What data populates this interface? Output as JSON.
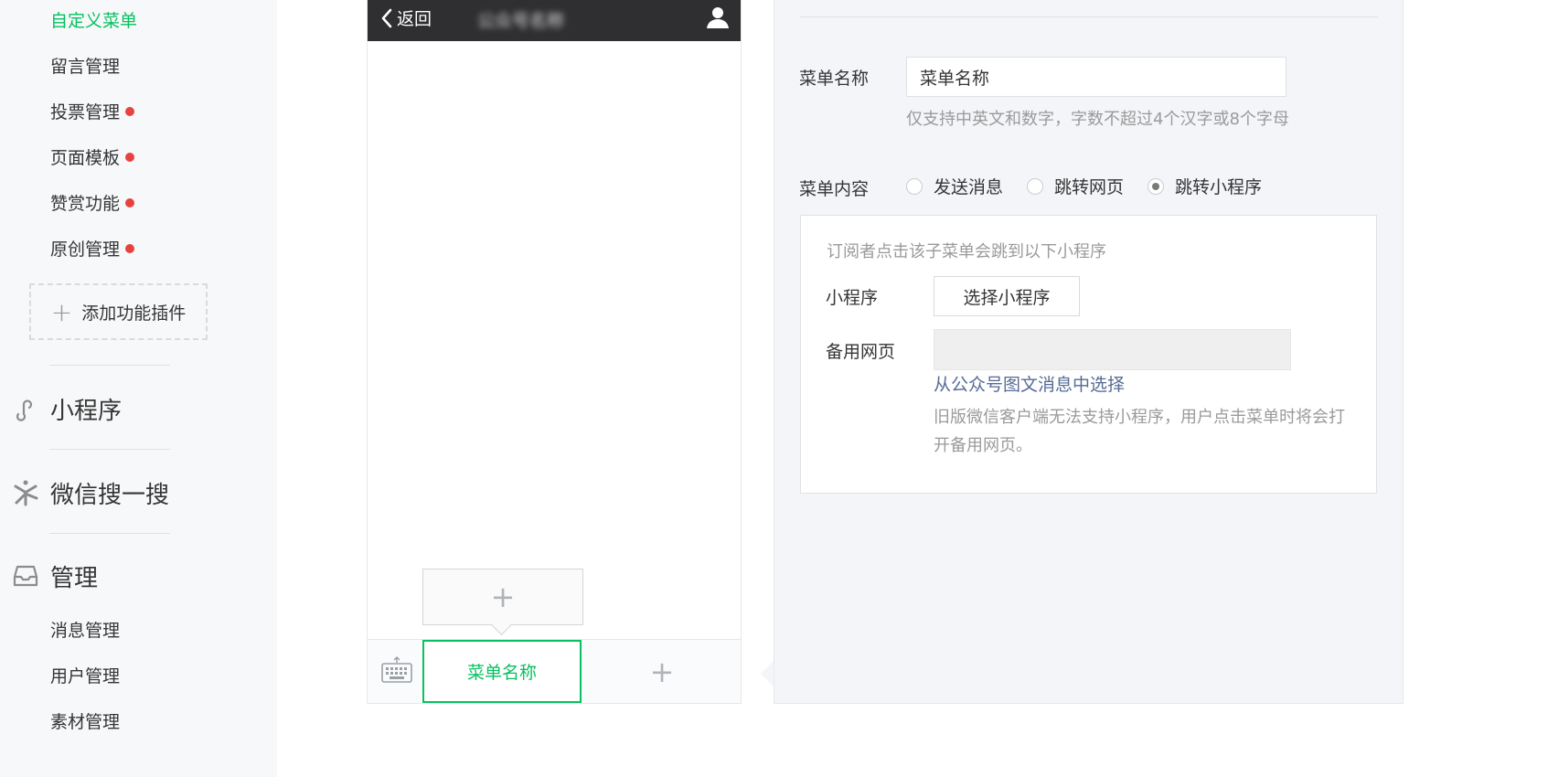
{
  "sidebar": {
    "items": [
      {
        "label": "自定义菜单",
        "active": true,
        "dot": false
      },
      {
        "label": "留言管理",
        "active": false,
        "dot": false
      },
      {
        "label": "投票管理",
        "active": false,
        "dot": true
      },
      {
        "label": "页面模板",
        "active": false,
        "dot": true
      },
      {
        "label": "赞赏功能",
        "active": false,
        "dot": true
      },
      {
        "label": "原创管理",
        "active": false,
        "dot": true
      }
    ],
    "add_plugin_label": "添加功能插件",
    "sections": [
      {
        "label": "小程序",
        "icon": "mini-program-icon"
      },
      {
        "label": "微信搜一搜",
        "icon": "search-one-search-icon"
      },
      {
        "label": "管理",
        "icon": "inbox-icon"
      }
    ],
    "manage_items": [
      "消息管理",
      "用户管理",
      "素材管理"
    ],
    "accent_color": "#07c160",
    "dot_color": "#e64340"
  },
  "phone": {
    "back_label": "返回",
    "account_name": "公众号名称",
    "menu_item_label": "菜单名称",
    "add_symbol": "+",
    "popup_add_symbol": "+"
  },
  "editor": {
    "name_label": "菜单名称",
    "name_value": "菜单名称",
    "name_hint": "仅支持中英文和数字，字数不超过4个汉字或8个字母",
    "content_label": "菜单内容",
    "options": [
      "发送消息",
      "跳转网页",
      "跳转小程序"
    ],
    "selected_option": "跳转小程序",
    "mp_desc": "订阅者点击该子菜单会跳到以下小程序",
    "mp_label": "小程序",
    "select_mp_button": "选择小程序",
    "backup_label": "备用网页",
    "backup_value": "",
    "choose_link": "从公众号图文消息中选择",
    "note": "旧版微信客户端无法支持小程序，用户点击菜单时将会打开备用网页。",
    "link_color": "#576b95"
  }
}
